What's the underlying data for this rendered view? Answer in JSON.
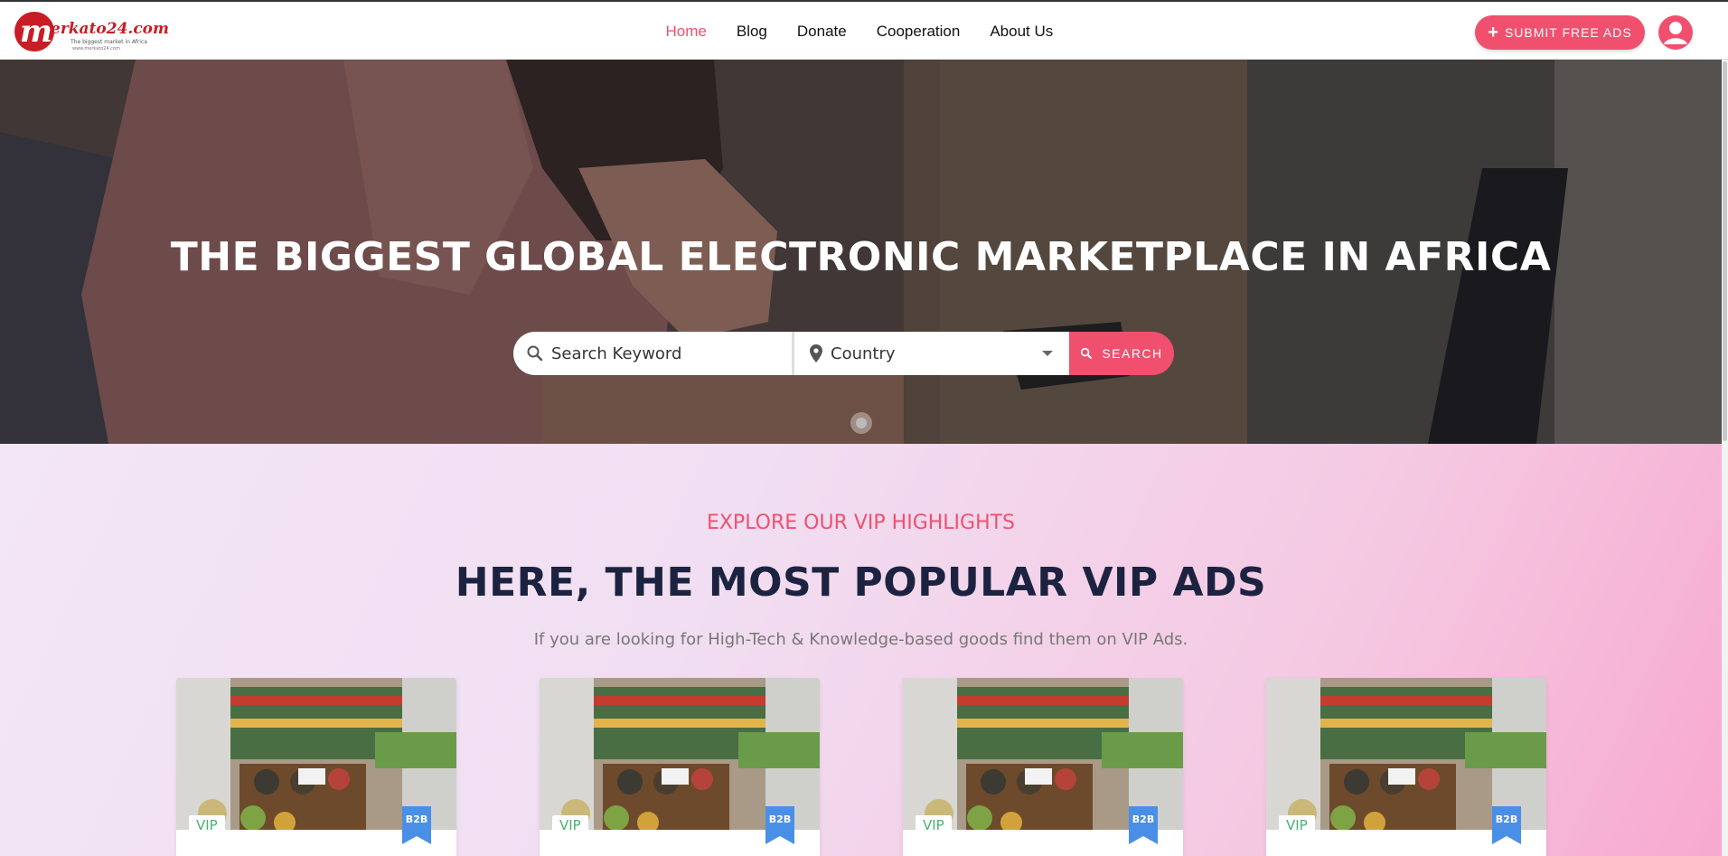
{
  "brand": {
    "logo_letter": "m",
    "logo_text": "erkato24.com",
    "logo_tagline": "The biggest market in Africa",
    "logo_tagline2": "www.merkato24.com"
  },
  "nav": {
    "items": [
      {
        "label": "Home",
        "active": true
      },
      {
        "label": "Blog",
        "active": false
      },
      {
        "label": "Donate",
        "active": false
      },
      {
        "label": "Cooperation",
        "active": false
      },
      {
        "label": "About Us",
        "active": false
      }
    ],
    "submit_label": "SUBMIT FREE ADS"
  },
  "hero": {
    "title": "THE BIGGEST GLOBAL ELECTRONIC MARKETPLACE IN AFRICA",
    "search_placeholder": "Search Keyword",
    "country_label": "Country",
    "search_button": "SEARCH"
  },
  "vip": {
    "eyebrow": "EXPLORE OUR VIP HIGHLIGHTS",
    "title": "HERE, THE MOST POPULAR VIP ADS",
    "subtitle": "If you are looking for High-Tech & Knowledge-based goods find them on VIP Ads.",
    "cards": [
      {
        "tag": "VIP",
        "badge": "B2B"
      },
      {
        "tag": "VIP",
        "badge": "B2B"
      },
      {
        "tag": "VIP",
        "badge": "B2B"
      },
      {
        "tag": "VIP",
        "badge": "B2B"
      }
    ]
  },
  "icons": [
    "plus-icon",
    "user-icon",
    "search-icon",
    "location-pin-icon",
    "chevron-down-icon",
    "bookmark-icon"
  ],
  "colors": {
    "accent": "#f0506e",
    "title_dark": "#1c2340",
    "vip_green": "#4caf72",
    "badge_blue": "#4a8fe7"
  }
}
